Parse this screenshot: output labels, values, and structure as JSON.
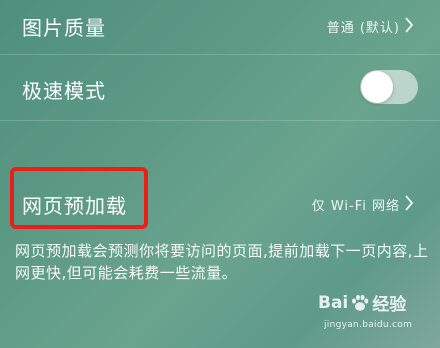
{
  "settings": {
    "image_quality": {
      "label": "图片质量",
      "value": "普通 (默认)"
    },
    "speed_mode": {
      "label": "极速模式",
      "toggle_on": false
    },
    "preload": {
      "label": "网页预加载",
      "value": "仅 Wi-Fi 网络"
    }
  },
  "description": "网页预加载会预测你将要访问的页面,提前加载下一页内容,上网更快,但可能会耗费一些流量。",
  "watermark": {
    "brand_left": "Bai",
    "brand_right": "经验",
    "url": "jingyan.baidu.com"
  },
  "colors": {
    "highlight": "#e8201a",
    "toggle_track": "#ffffff8c"
  }
}
